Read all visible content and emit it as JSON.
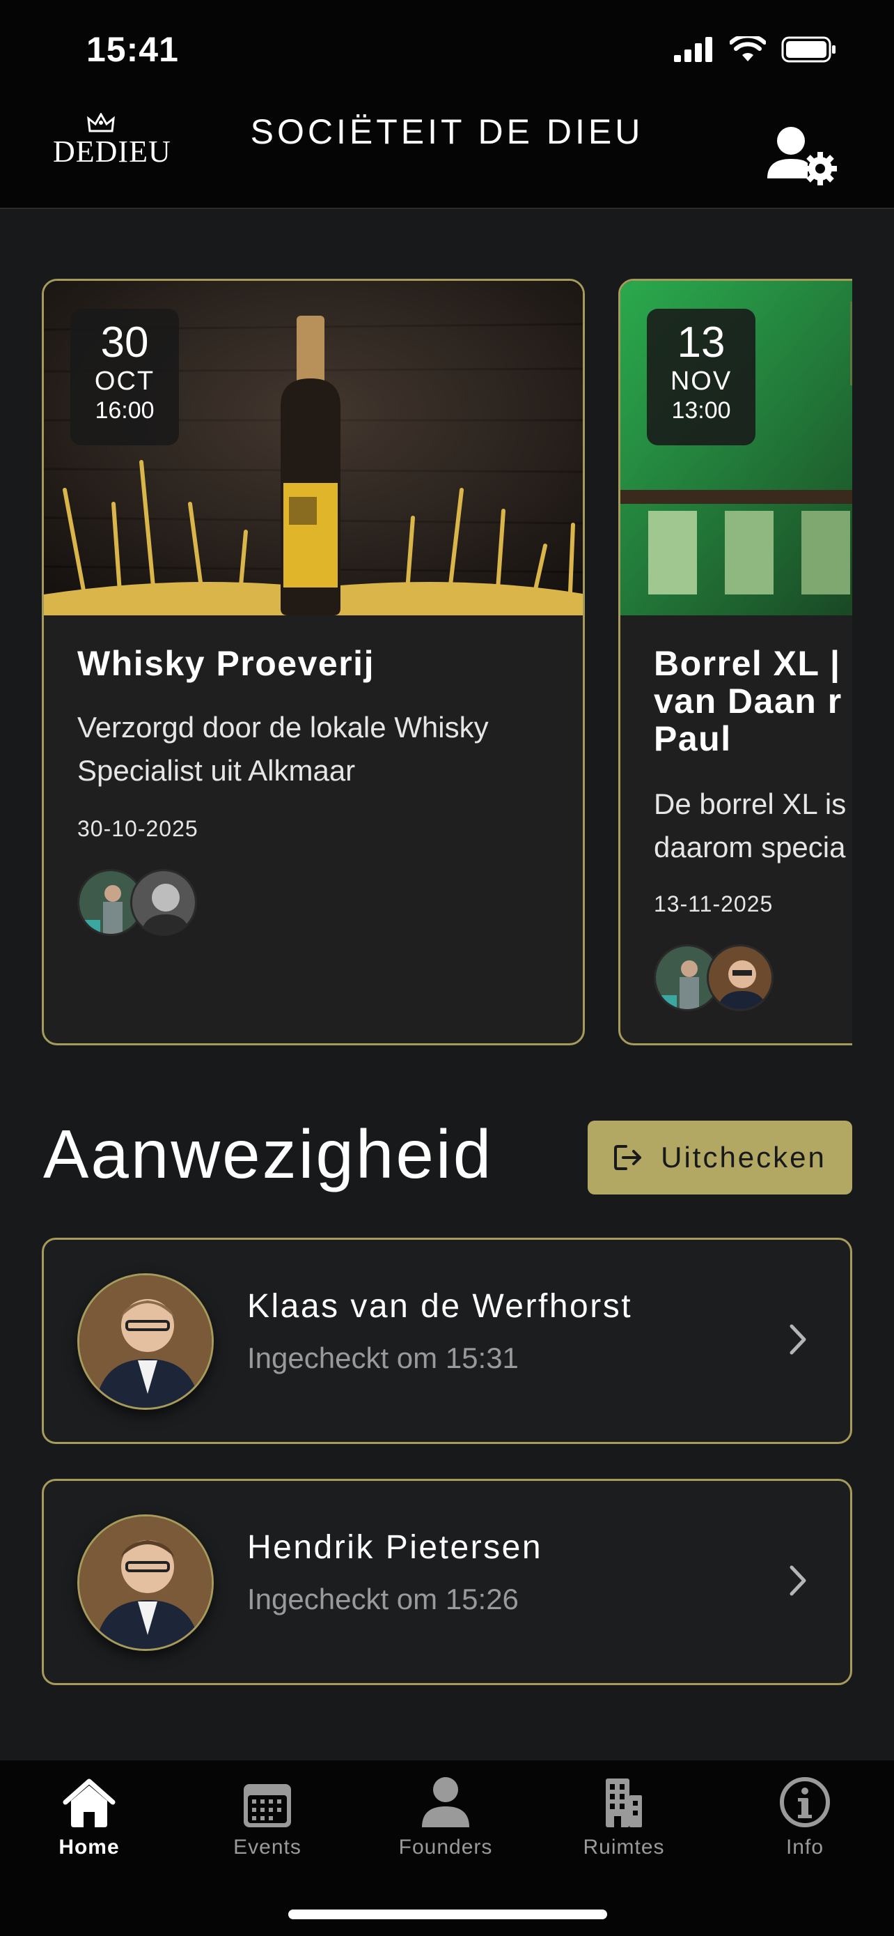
{
  "status_bar": {
    "time": "15:41"
  },
  "header": {
    "logo_text": "DEDIEU",
    "title": "SOCIËTEIT DE DIEU"
  },
  "events": [
    {
      "day": "30",
      "month": "OCT",
      "time": "16:00",
      "title": "Whisky Proeverij",
      "description": "Verzorgd door de lokale Whisky Specialist uit Alkmaar",
      "date": "30-10-2025"
    },
    {
      "day": "13",
      "month": "NOV",
      "time": "13:00",
      "title": "Borrel XL | van Daan r Paul",
      "description": "De borrel XL is daarom specia",
      "date": "13-11-2025"
    }
  ],
  "presence": {
    "title": "Aanwezigheid",
    "checkout_label": "Uitchecken",
    "people": [
      {
        "name": "Klaas van de Werfhorst",
        "status": "Ingecheckt om 15:31"
      },
      {
        "name": "Hendrik Pietersen",
        "status": "Ingecheckt om 15:26"
      }
    ]
  },
  "tabs": [
    {
      "label": "Home",
      "icon": "home-icon",
      "active": true
    },
    {
      "label": "Events",
      "icon": "calendar-icon",
      "active": false
    },
    {
      "label": "Founders",
      "icon": "person-icon",
      "active": false
    },
    {
      "label": "Ruimtes",
      "icon": "building-icon",
      "active": false
    },
    {
      "label": "Info",
      "icon": "info-icon",
      "active": false
    }
  ],
  "colors": {
    "accent_gold": "#b2a863",
    "card_border": "#a69b5b",
    "background": "#18191b"
  }
}
